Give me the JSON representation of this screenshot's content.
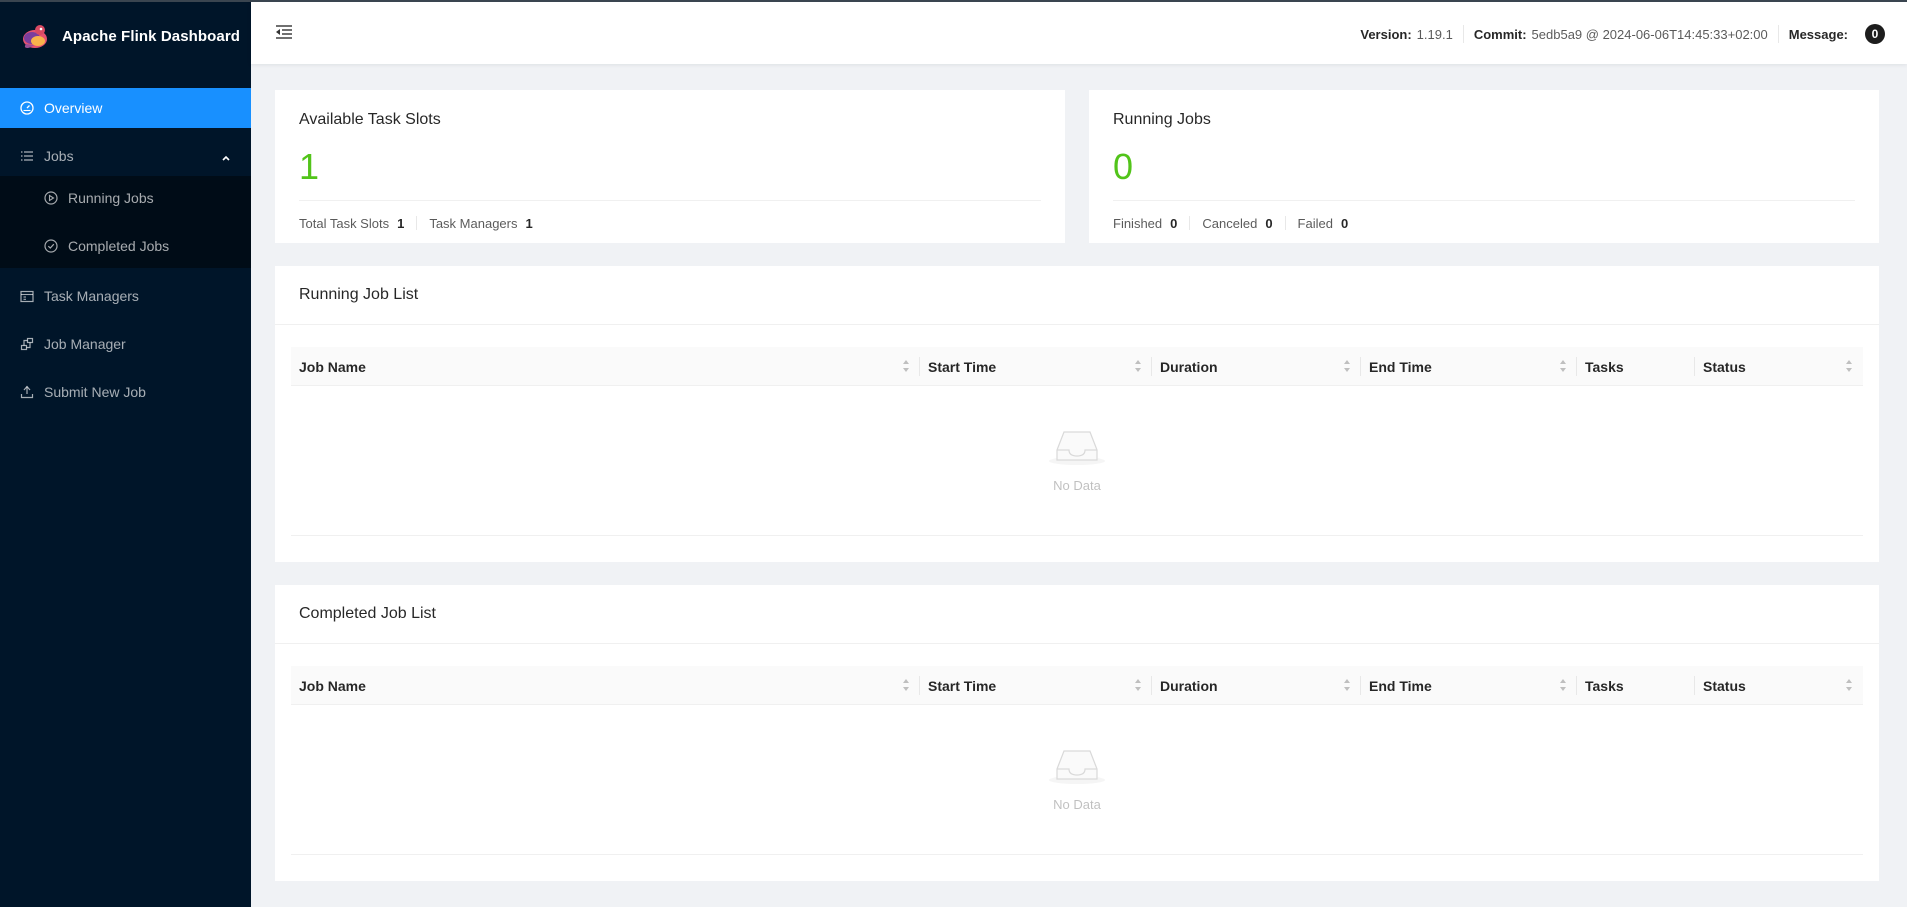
{
  "brand": {
    "title": "Apache Flink Dashboard"
  },
  "sidebar": {
    "items": [
      {
        "label": "Overview",
        "icon": "dashboard-icon"
      },
      {
        "label": "Jobs",
        "icon": "list-icon"
      },
      {
        "label": "Running Jobs",
        "icon": "play-circle-icon"
      },
      {
        "label": "Completed Jobs",
        "icon": "check-circle-icon"
      },
      {
        "label": "Task Managers",
        "icon": "schedule-icon"
      },
      {
        "label": "Job Manager",
        "icon": "cluster-icon"
      },
      {
        "label": "Submit New Job",
        "icon": "upload-icon"
      }
    ],
    "active_color": "#1890ff"
  },
  "header": {
    "version_label": "Version:",
    "version_value": "1.19.1",
    "commit_label": "Commit:",
    "commit_value": "5edb5a9 @ 2024-06-06T14:45:33+02:00",
    "message_label": "Message:",
    "message_count": "0"
  },
  "task_slots": {
    "title": "Available Task Slots",
    "value": "1",
    "total_label": "Total Task Slots",
    "total_value": "1",
    "tm_label": "Task Managers",
    "tm_value": "1"
  },
  "running_jobs": {
    "title": "Running Jobs",
    "value": "0",
    "finished_label": "Finished",
    "finished_value": "0",
    "canceled_label": "Canceled",
    "canceled_value": "0",
    "failed_label": "Failed",
    "failed_value": "0"
  },
  "running_list": {
    "title": "Running Job List",
    "empty_text": "No Data"
  },
  "completed_list": {
    "title": "Completed Job List",
    "empty_text": "No Data"
  },
  "columns": [
    "Job Name",
    "Start Time",
    "Duration",
    "End Time",
    "Tasks",
    "Status"
  ],
  "accent_green": "#52c41a"
}
